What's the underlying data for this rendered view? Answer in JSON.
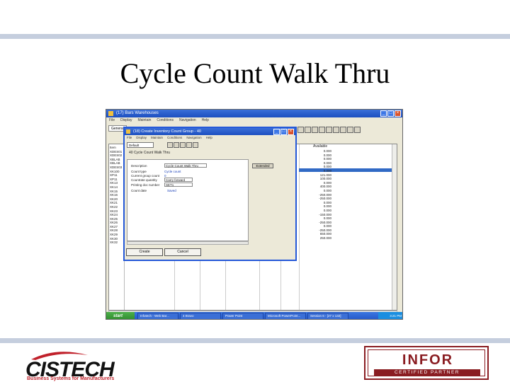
{
  "slide": {
    "title": "Cycle Count Walk Thru"
  },
  "app_window": {
    "title": "(17) Bars Warehouses",
    "menu": [
      "File",
      "Display",
      "Maintain",
      "Conditions",
      "Navigation",
      "Help"
    ],
    "tab": "General",
    "left_rows": [
      "Item",
      "XDES01",
      "XDES02",
      "XBLAB",
      "XBLAB",
      "XDES03",
      "XK100",
      "XP11",
      "XP11",
      "XK13",
      "XK14",
      "XK15",
      "XK16",
      "XK20",
      "XK21",
      "XK22",
      "XK23",
      "XK24",
      "XK25",
      "XK26",
      "XK27",
      "XK28",
      "XK29",
      "XK30",
      "XK32"
    ],
    "right_header": "Available",
    "right_values": [
      "0.000",
      "0.000",
      "0.000",
      "0.000",
      "0.000",
      "0.000",
      "121.000",
      "100.000",
      "0.000",
      "400.000",
      "0.000",
      "-250.000",
      "-250.000",
      "0.000",
      "0.000",
      "0.000",
      "-150.000",
      "0.000",
      "-250.000",
      "0.000",
      "-250.000",
      "650.000",
      "250.000"
    ]
  },
  "dialog": {
    "title": "(18) Create Inventory Count Group - 40",
    "menu": [
      "File",
      "Display",
      "Maintain",
      "Conditions",
      "Navigation",
      "Help"
    ],
    "select_value": "Default",
    "heading": "40  Cycle Count Walk Thru",
    "fields": [
      {
        "label": "Description",
        "value": "Cycle Count Walk Thru",
        "kind": "input"
      },
      {
        "label": "Count type",
        "value": "Cycle count",
        "kind": "text"
      },
      {
        "label": "Current group count",
        "value": "0",
        "kind": "text"
      },
      {
        "label": "Countrate quantity",
        "value": "Carry forward",
        "kind": "input"
      },
      {
        "label": "Printing doc number",
        "value": "SET1",
        "kind": "input"
      },
      {
        "label": "Count date",
        "value": "Saved",
        "kind": "text"
      }
    ],
    "side_button": "Extended",
    "create_label": "Create",
    "cancel_label": "Cancel"
  },
  "taskbar": {
    "start": "start",
    "tasks": [
      "Infotech - Web Bar...",
      "4 Bravo",
      "Power Point",
      "Microsoft PowerPoint...",
      "Session 6 - [27 x 132]"
    ],
    "clock": "3:21 PM"
  },
  "logos": {
    "cistech_word": "CISTECH",
    "cistech_sub": "Business Systems for Manufacturers",
    "infor_word": "INFOR",
    "infor_cert": "CERTIFIED PARTNER"
  }
}
